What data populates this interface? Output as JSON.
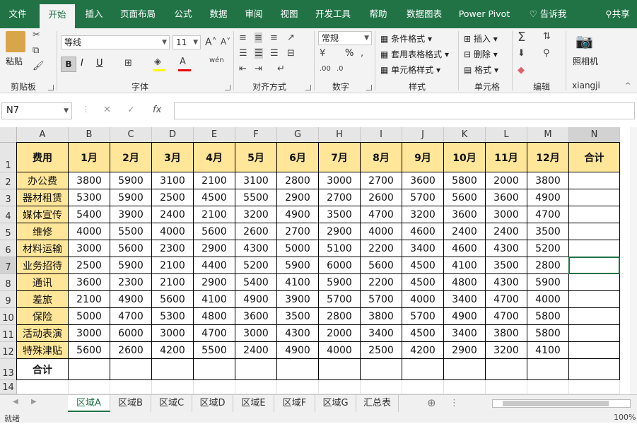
{
  "menu_tabs": [
    "文件",
    "开始",
    "插入",
    "页面布局",
    "公式",
    "数据",
    "审阅",
    "视图",
    "开发工具",
    "帮助",
    "数据图表",
    "Power Pivot",
    "告诉我",
    "共享"
  ],
  "ribbon": {
    "clipboard": {
      "paste": "粘贴",
      "label": "剪贴板"
    },
    "font": {
      "name": "等线",
      "size": "11",
      "label": "字体",
      "bold": "B",
      "italic": "I",
      "underline": "U"
    },
    "alignment": {
      "label": "对齐方式"
    },
    "number": {
      "format": "常规",
      "label": "数字",
      "percent": "%"
    },
    "styles": {
      "conditional": "条件格式",
      "table": "套用表格格式",
      "cell": "单元格样式",
      "label": "样式"
    },
    "cells": {
      "insert": "插入",
      "delete": "删除",
      "format": "格式",
      "label": "单元格"
    },
    "editing": {
      "label": "编辑"
    },
    "camera": {
      "label": "照相机",
      "group": "xiangji"
    }
  },
  "formula_bar": {
    "name_box": "N7",
    "fx": "fx",
    "value": ""
  },
  "columns": [
    "A",
    "B",
    "C",
    "D",
    "E",
    "F",
    "G",
    "H",
    "I",
    "J",
    "K",
    "L",
    "M",
    "N"
  ],
  "rows": [
    "1",
    "2",
    "3",
    "4",
    "5",
    "6",
    "7",
    "8",
    "9",
    "10",
    "11",
    "12",
    "13",
    "14"
  ],
  "table": {
    "header": [
      "费用",
      "1月",
      "2月",
      "3月",
      "4月",
      "5月",
      "6月",
      "7月",
      "8月",
      "9月",
      "10月",
      "11月",
      "12月",
      "合计"
    ],
    "rows": [
      {
        "name": "办公费",
        "values": [
          "3800",
          "5900",
          "3100",
          "2100",
          "3100",
          "2800",
          "3000",
          "2700",
          "3600",
          "5800",
          "2000",
          "3800"
        ]
      },
      {
        "name": "器材租赁",
        "values": [
          "5300",
          "5900",
          "2500",
          "4500",
          "5500",
          "2900",
          "2700",
          "2600",
          "5700",
          "5600",
          "3600",
          "4900"
        ]
      },
      {
        "name": "媒体宣传",
        "values": [
          "5400",
          "3900",
          "2400",
          "2100",
          "3200",
          "4900",
          "3500",
          "4700",
          "3200",
          "3600",
          "3000",
          "4700"
        ]
      },
      {
        "name": "维修",
        "values": [
          "4000",
          "5500",
          "4000",
          "5600",
          "2600",
          "2700",
          "2900",
          "4000",
          "4600",
          "2400",
          "2400",
          "3500"
        ]
      },
      {
        "name": "材料运输",
        "values": [
          "3000",
          "5600",
          "2300",
          "2900",
          "4300",
          "5000",
          "5100",
          "2200",
          "3400",
          "4600",
          "4300",
          "5200"
        ]
      },
      {
        "name": "业务招待",
        "values": [
          "2500",
          "5900",
          "2100",
          "4400",
          "5200",
          "5900",
          "6000",
          "5600",
          "4500",
          "4100",
          "3500",
          "2800"
        ]
      },
      {
        "name": "通讯",
        "values": [
          "3600",
          "2300",
          "2100",
          "2900",
          "5400",
          "4100",
          "5900",
          "2200",
          "4500",
          "4800",
          "4300",
          "5900"
        ]
      },
      {
        "name": "差旅",
        "values": [
          "2100",
          "4900",
          "5600",
          "4100",
          "4900",
          "3900",
          "5700",
          "5700",
          "4000",
          "3400",
          "4700",
          "4000"
        ]
      },
      {
        "name": "保险",
        "values": [
          "5000",
          "4700",
          "5300",
          "4800",
          "3600",
          "3500",
          "2800",
          "3800",
          "5700",
          "4900",
          "4700",
          "5800"
        ]
      },
      {
        "name": "活动表演",
        "values": [
          "3000",
          "6000",
          "3000",
          "4700",
          "3000",
          "4300",
          "2000",
          "3400",
          "4500",
          "3400",
          "3800",
          "5800"
        ]
      },
      {
        "name": "特殊津贴",
        "values": [
          "5600",
          "2600",
          "4200",
          "5500",
          "2400",
          "4900",
          "4000",
          "2500",
          "4200",
          "2900",
          "3200",
          "4100"
        ]
      }
    ],
    "total_label": "合计"
  },
  "sheets": [
    "区域A",
    "区域B",
    "区域C",
    "区域D",
    "区域E",
    "区域F",
    "区域G",
    "汇总表"
  ],
  "status": {
    "ready": "就绪",
    "zoom": "100%"
  },
  "colors": {
    "excel_green": "#217346",
    "header_fill": "#ffe699"
  }
}
